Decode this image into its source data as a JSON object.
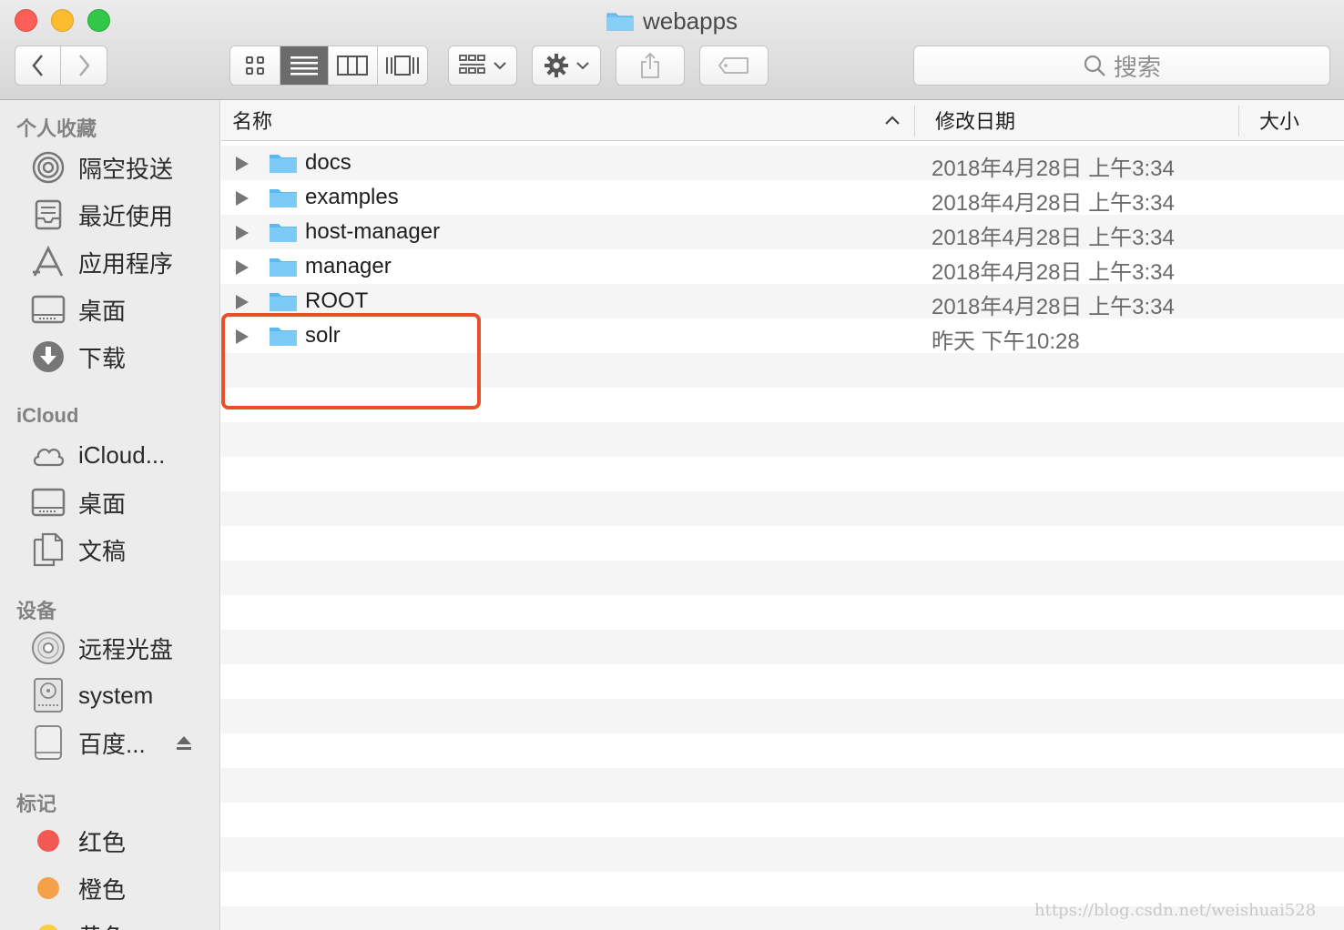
{
  "window": {
    "title": "webapps"
  },
  "toolbar": {
    "view_modes": [
      "icon-view",
      "list-view",
      "column-view",
      "cover-flow-view"
    ],
    "active_view": "list-view",
    "search_placeholder": "搜索"
  },
  "sidebar": {
    "favorites_title": "个人收藏",
    "favorites": [
      {
        "label": "隔空投送",
        "icon": "airdrop-icon"
      },
      {
        "label": "最近使用",
        "icon": "recents-icon"
      },
      {
        "label": "应用程序",
        "icon": "applications-icon"
      },
      {
        "label": "桌面",
        "icon": "desktop-icon"
      },
      {
        "label": "下载",
        "icon": "downloads-icon"
      }
    ],
    "icloud_title": "iCloud",
    "icloud": [
      {
        "label": "iCloud...",
        "icon": "icloud-icon"
      },
      {
        "label": "桌面",
        "icon": "desktop-icon"
      },
      {
        "label": "文稿",
        "icon": "documents-icon"
      }
    ],
    "devices_title": "设备",
    "devices": [
      {
        "label": "远程光盘",
        "icon": "remote-disc-icon"
      },
      {
        "label": "system",
        "icon": "hard-drive-icon"
      },
      {
        "label": "百度...",
        "icon": "external-drive-icon"
      }
    ],
    "tags_title": "标记",
    "tags": [
      {
        "label": "红色",
        "color": "#f25953"
      },
      {
        "label": "橙色",
        "color": "#f4a14a"
      },
      {
        "label": "黄色",
        "color": "#f7cf46"
      }
    ]
  },
  "columns": {
    "name": "名称",
    "modified": "修改日期",
    "size": "大小"
  },
  "files": [
    {
      "name": "docs",
      "modified": "2018年4月28日 上午3:34"
    },
    {
      "name": "examples",
      "modified": "2018年4月28日 上午3:34"
    },
    {
      "name": "host-manager",
      "modified": "2018年4月28日 上午3:34"
    },
    {
      "name": "manager",
      "modified": "2018年4月28日 上午3:34"
    },
    {
      "name": "ROOT",
      "modified": "2018年4月28日 上午3:34"
    },
    {
      "name": "solr",
      "modified": "昨天 下午10:28"
    }
  ],
  "watermark": "https://blog.csdn.net/weishuai528",
  "colors": {
    "folder": "#6fc3f5",
    "highlight": "#e8502b"
  }
}
